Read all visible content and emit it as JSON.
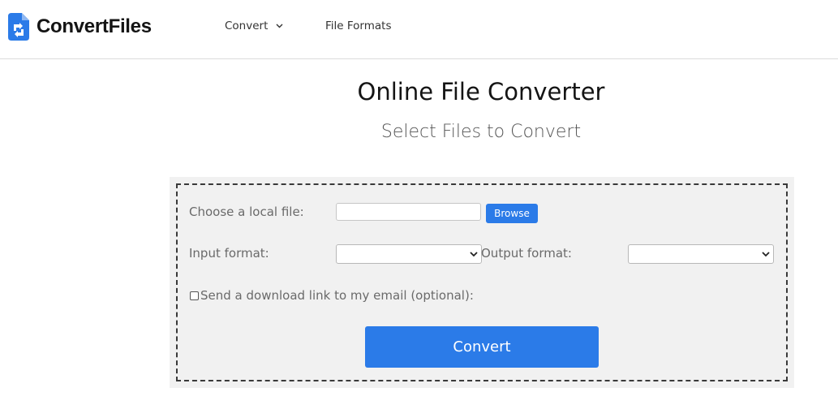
{
  "header": {
    "logo_text": "ConvertFiles",
    "nav": {
      "convert_label": "Convert",
      "formats_label": "File Formats"
    }
  },
  "main": {
    "title": "Online File Converter",
    "subtitle": "Select Files to Convert"
  },
  "form": {
    "local_file_label": "Choose a local file:",
    "file_value": "",
    "browse_label": "Browse",
    "input_format_label": "Input format:",
    "input_format_value": "",
    "output_format_label": "Output format:",
    "output_format_value": "",
    "email_checkbox_label": "Send a download link to my email (optional):",
    "email_checked": false,
    "convert_label": "Convert"
  },
  "colors": {
    "accent": "#2b7be8",
    "panel_bg": "#f1f1f1"
  },
  "icons": {
    "logo": "file-convert-icon",
    "nav_dropdown": "chevron-down-icon",
    "select_arrow": "chevron-down-icon"
  }
}
